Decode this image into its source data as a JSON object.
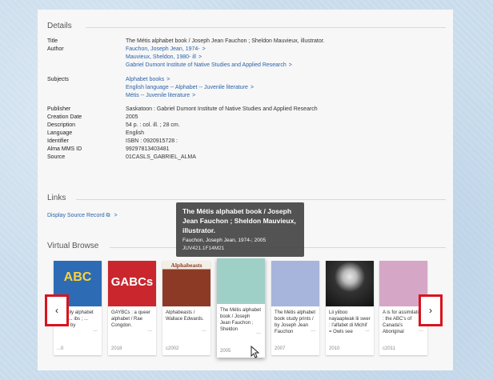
{
  "details": {
    "heading": "Details",
    "rows": [
      {
        "label": "Title",
        "values": [
          "The Métis alphabet book / Joseph Jean Fauchon ; Sheldon Mauvieux, illustrator."
        ]
      },
      {
        "label": "Author",
        "values": [
          "Fauchon, Joseph Jean, 1974-",
          "Mauvieux, Sheldon, 1980- ill",
          "Gabriel Dumont Institute of Native Studies and Applied Research"
        ],
        "link": true
      },
      {
        "label": "Subjects",
        "values": [
          "Alphabet books",
          "English language -- Alphabet -- Juvenile literature",
          "Métis -- Juvenile literature"
        ],
        "link": true
      },
      {
        "label": "Publisher",
        "values": [
          "Saskatoon : Gabriel Dumont Institute of Native Studies and Applied Research"
        ]
      },
      {
        "label": "Creation Date",
        "values": [
          "2005"
        ]
      },
      {
        "label": "Description",
        "values": [
          "54 p. : col. ill. ; 28 cm."
        ]
      },
      {
        "label": "Language",
        "values": [
          "English"
        ]
      },
      {
        "label": "Identifier",
        "values": [
          "ISBN : 0920915728 :"
        ]
      },
      {
        "label": "Alma MMS ID",
        "values": [
          "99297813403481"
        ]
      },
      {
        "label": "Source",
        "values": [
          "01CASLS_GABRIEL_ALMA"
        ]
      }
    ]
  },
  "links": {
    "heading": "Links",
    "display_source": "Display Source Record",
    "external_icon": "external-link-icon"
  },
  "virtual_browse": {
    "heading": "Virtual Browse",
    "prev_icon": "chevron-left-icon",
    "next_icon": "chevron-right-icon",
    "tooltip": {
      "title": "The Métis alphabet book / Joseph Jean Fauchon ; Sheldon Mauvieux, illustrator.",
      "author_date": "Fauchon, Joseph Jean, 1974-; 2005",
      "call_number": "JUV421.1F14M21"
    },
    "cards": [
      {
        "title": "A family alphabet book ... ibs ; ... trated by",
        "date": "...0",
        "cover_text": "ABC",
        "cover_color": "#2d6cb5"
      },
      {
        "title": "GAYBCs : a queer alphabet / Rae Congdon.",
        "date": "2018",
        "cover_text": "GABCs",
        "cover_color": "#c9272d"
      },
      {
        "title": "Alphabeasts / Wallace Edwards.",
        "date": "c2002",
        "cover_text": "Alphabeasts",
        "cover_color": "#8c3a25"
      },
      {
        "title": "The Métis alphabet book / Joseph Jean Fauchon ; Sheldon",
        "date": "2005",
        "cover_text": "",
        "cover_color": "#9fd0c8"
      },
      {
        "title": "The Métis alphabet book study prints / by Joseph Jean Fauchon",
        "date": "2007",
        "cover_text": "",
        "cover_color": "#a7b4dc"
      },
      {
        "title": "Lii yiiboo nayaapiwak lii swer : l'alfabet di Michif = Owls see",
        "date": "2010",
        "cover_text": "",
        "cover_color": "#2a2a2a"
      },
      {
        "title": "A is for assimilation : the ABC's of Canada's Aboriginal",
        "date": "c2011",
        "cover_text": "",
        "cover_color": "#d6a6c6"
      }
    ]
  },
  "more_glyph": "...",
  "chevron_glyph": ">",
  "prev_glyph": "‹",
  "next_glyph": "›",
  "external_glyph": "⧉"
}
